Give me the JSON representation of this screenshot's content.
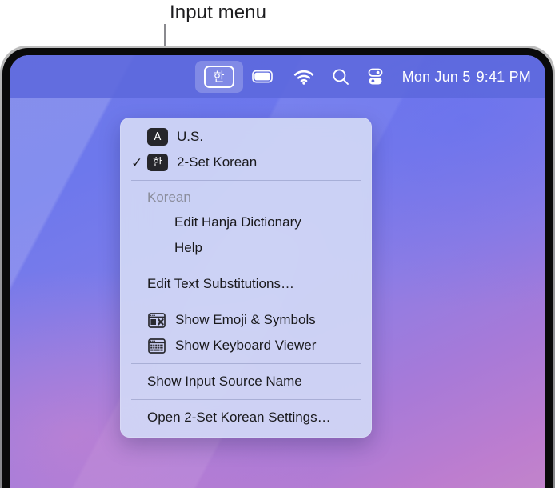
{
  "callout": {
    "label": "Input menu"
  },
  "menubar": {
    "input_menu": {
      "icon_name": "input-source-korean-icon",
      "glyph": "한",
      "active": true
    },
    "items": [
      {
        "name": "battery-icon",
        "label": "Battery"
      },
      {
        "name": "wifi-icon",
        "label": "Wi-Fi"
      },
      {
        "name": "spotlight-search-icon",
        "label": "Spotlight Search"
      },
      {
        "name": "control-center-icon",
        "label": "Control Center"
      }
    ],
    "clock": {
      "date": "Mon Jun 5",
      "time": "9:41 PM"
    }
  },
  "menu": {
    "groups": [
      {
        "items": [
          {
            "type": "source",
            "checked": false,
            "badge": "A",
            "label": "U.S.",
            "name": "menu-item-us"
          },
          {
            "type": "source",
            "checked": true,
            "badge": "한",
            "label": "2-Set Korean",
            "name": "menu-item-2-set-korean"
          }
        ]
      },
      {
        "header": "Korean",
        "items": [
          {
            "type": "sub",
            "label": "Edit Hanja Dictionary",
            "name": "menu-item-edit-hanja-dictionary"
          },
          {
            "type": "sub",
            "label": "Help",
            "name": "menu-item-help"
          }
        ]
      },
      {
        "items": [
          {
            "type": "plain",
            "label": "Edit Text Substitutions…",
            "name": "menu-item-edit-text-substitutions"
          }
        ]
      },
      {
        "items": [
          {
            "type": "icon",
            "icon": "emoji-symbols-icon",
            "label": "Show Emoji & Symbols",
            "name": "menu-item-show-emoji-symbols"
          },
          {
            "type": "icon",
            "icon": "keyboard-viewer-icon",
            "label": "Show Keyboard Viewer",
            "name": "menu-item-show-keyboard-viewer"
          }
        ]
      },
      {
        "items": [
          {
            "type": "plain",
            "label": "Show Input Source Name",
            "name": "menu-item-show-input-source-name"
          }
        ]
      },
      {
        "items": [
          {
            "type": "plain",
            "label": "Open 2-Set Korean Settings…",
            "name": "menu-item-open-2-set-korean-settings"
          }
        ]
      }
    ],
    "checkmark": "✓"
  },
  "colors": {
    "menubar_bg": "#5c68dc",
    "menu_panel_bg": "#d1d7f5",
    "badge_bg": "#26262b",
    "text": "#19191c",
    "section_header_text": "#8b8d9c",
    "bezel": "#0a0a0a"
  }
}
